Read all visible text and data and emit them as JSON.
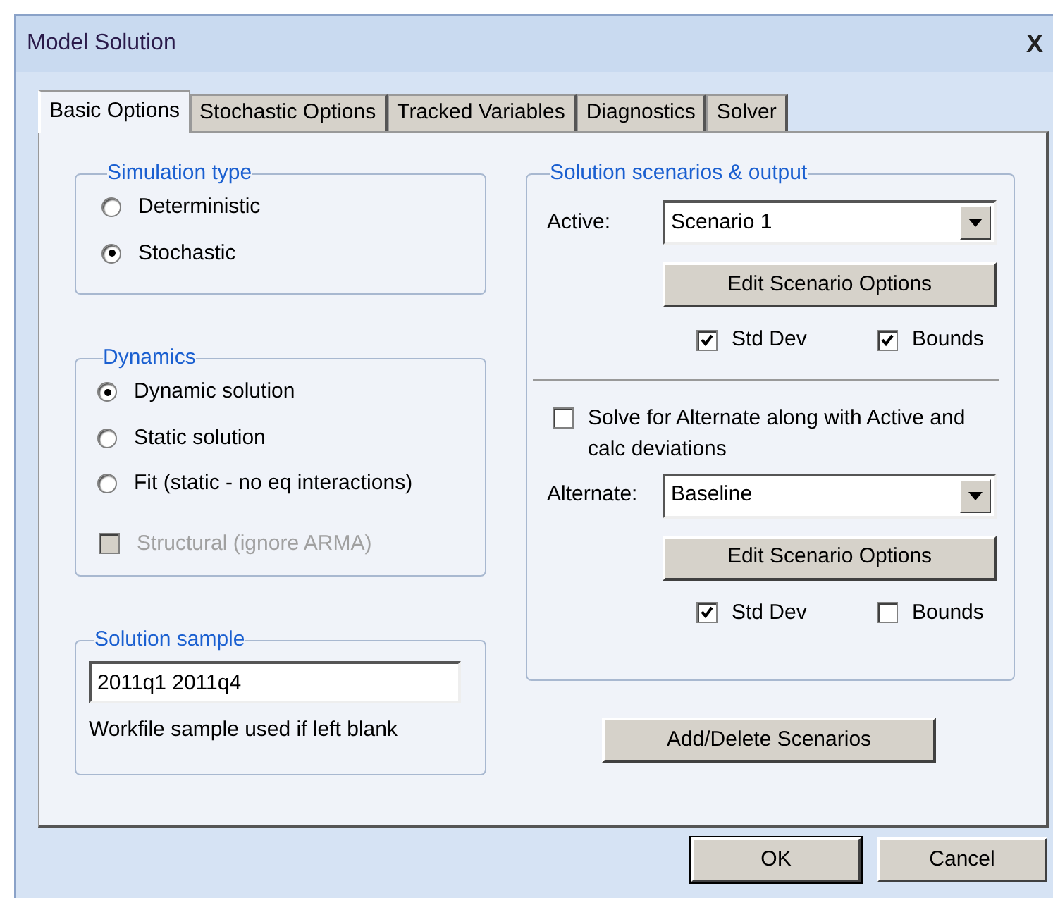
{
  "window": {
    "title": "Model Solution",
    "close": "X"
  },
  "tabs": [
    {
      "label": "Basic Options",
      "selected": true
    },
    {
      "label": "Stochastic Options",
      "selected": false
    },
    {
      "label": "Tracked Variables",
      "selected": false
    },
    {
      "label": "Diagnostics",
      "selected": false
    },
    {
      "label": "Solver",
      "selected": false
    }
  ],
  "simulation_type": {
    "title": "Simulation type",
    "options": [
      {
        "label": "Deterministic",
        "selected": false
      },
      {
        "label": "Stochastic",
        "selected": true
      }
    ]
  },
  "dynamics": {
    "title": "Dynamics",
    "options": [
      {
        "label": "Dynamic solution",
        "selected": true
      },
      {
        "label": "Static solution",
        "selected": false
      },
      {
        "label": "Fit (static - no eq interactions)",
        "selected": false
      }
    ],
    "structural": {
      "label": "Structural (ignore ARMA)",
      "checked": false,
      "disabled": true
    }
  },
  "solution_sample": {
    "title": "Solution sample",
    "value": "2011q1 2011q4",
    "note": "Workfile sample used if left blank"
  },
  "scenarios": {
    "title": "Solution scenarios & output",
    "active": {
      "label": "Active:",
      "value": "Scenario 1",
      "edit_button": "Edit Scenario Options",
      "checks": [
        {
          "label": "Std Dev",
          "checked": true
        },
        {
          "label": "Bounds",
          "checked": true
        }
      ]
    },
    "solve_alternate": {
      "label": "Solve for Alternate along with Active and calc deviations",
      "checked": false
    },
    "alternate": {
      "label": "Alternate:",
      "value": "Baseline",
      "edit_button": "Edit Scenario Options",
      "checks": [
        {
          "label": "Std Dev",
          "checked": true
        },
        {
          "label": "Bounds",
          "checked": false
        }
      ]
    }
  },
  "add_delete_button": "Add/Delete Scenarios",
  "buttons": [
    {
      "label": "OK",
      "default": true
    },
    {
      "label": "Cancel",
      "default": false
    }
  ]
}
